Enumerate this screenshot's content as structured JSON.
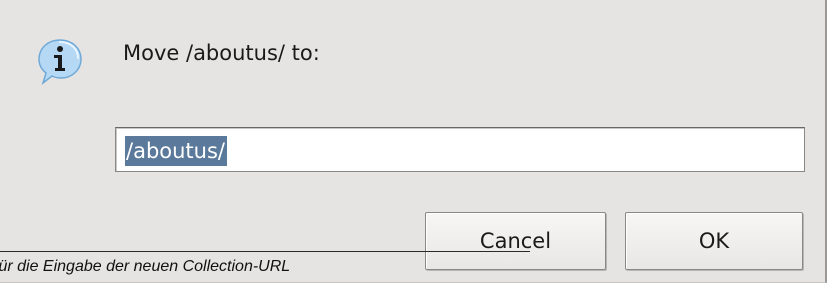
{
  "dialog": {
    "message": "Move /aboutus/ to:",
    "info_icon": "info-speech-bubble-icon",
    "input": {
      "value": "/aboutus/",
      "selected": true
    },
    "buttons": {
      "cancel_label": "Cancel",
      "ok_label": "OK"
    }
  },
  "annotation": {
    "caption": "für die Eingabe der neuen Collection-URL"
  },
  "colors": {
    "dialog_background": "#e6e4e2",
    "selection_highlight": "#5b7a9b",
    "icon_bubble": "#b5d8f5",
    "icon_glyph": "#1a1a1a"
  }
}
